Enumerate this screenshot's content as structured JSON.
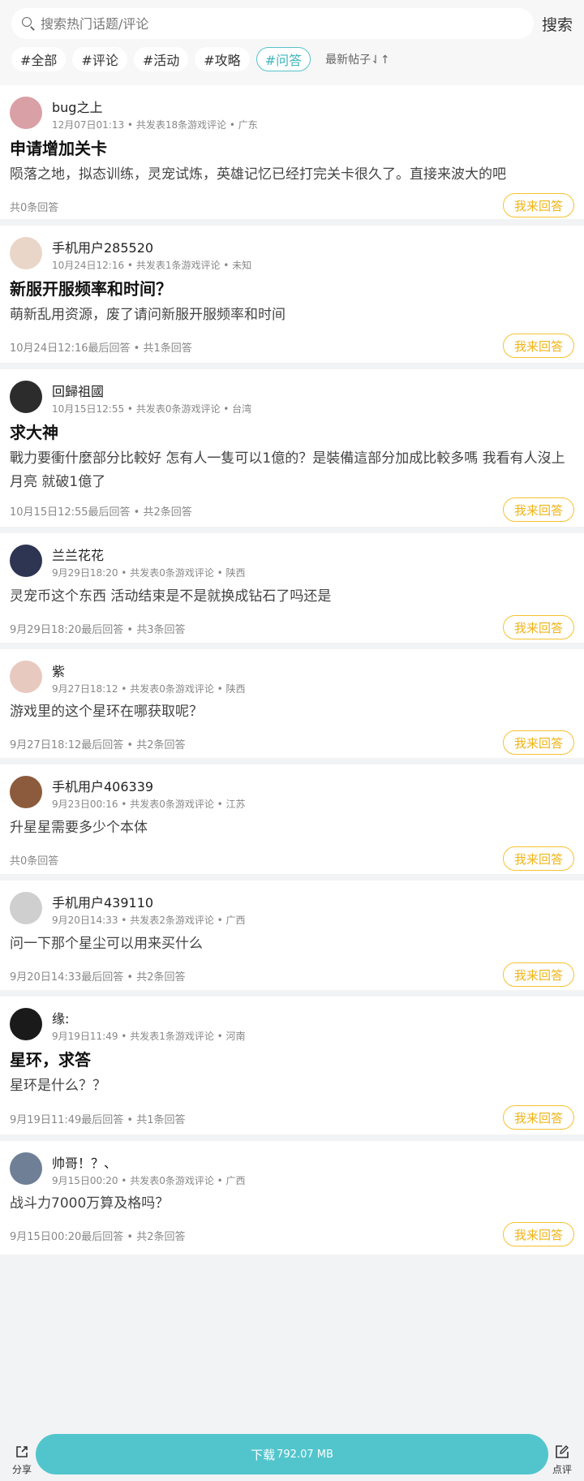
{
  "search": {
    "placeholder": "搜索热门话题/评论",
    "button_label": "搜索"
  },
  "tags": [
    {
      "label": "#全部",
      "active": false
    },
    {
      "label": "#评论",
      "active": false
    },
    {
      "label": "#活动",
      "active": false
    },
    {
      "label": "#攻略",
      "active": false
    },
    {
      "label": "#问答",
      "active": true
    }
  ],
  "sort_label": "最新帖子⇃↑",
  "answer_label": "我来回答",
  "posts": [
    {
      "author": "bug之上",
      "meta": "12月07日01:13 • 共发表18条游戏评论 • 广东",
      "title": "申请增加关卡",
      "content": "陨落之地，拟态训练，灵宠试炼，英雄记忆已经打完关卡很久了。直接来波大的吧",
      "stats": "共0条回答"
    },
    {
      "author": "手机用户285520",
      "meta": "10月24日12:16 • 共发表1条游戏评论 • 未知",
      "title": "新服开服频率和时间？",
      "content": "萌新乱用资源，废了请问新服开服频率和时间",
      "stats": "10月24日12:16最后回答 • 共1条回答"
    },
    {
      "author": "回歸祖國",
      "meta": "10月15日12:55 • 共发表0条游戏评论 • 台湾",
      "title": "求大神",
      "content": "戰力要衝什麼部分比較好 怎有人一隻可以1億的？是裝備這部分加成比較多嗎 我看有人沒上月亮 就破1億了",
      "stats": "10月15日12:55最后回答 • 共2条回答"
    },
    {
      "author": "兰兰花花",
      "meta": "9月29日18:20 • 共发表0条游戏评论 • 陕西",
      "title": "",
      "content": "灵宠币这个东西 活动结束是不是就换成钻石了吗还是",
      "stats": "9月29日18:20最后回答 • 共3条回答"
    },
    {
      "author": "紫",
      "meta": "9月27日18:12 • 共发表0条游戏评论 • 陕西",
      "title": "",
      "content": "游戏里的这个星环在哪获取呢？",
      "stats": "9月27日18:12最后回答 • 共2条回答"
    },
    {
      "author": "手机用户406339",
      "meta": "9月23日00:16 • 共发表0条游戏评论 • 江苏",
      "title": "",
      "content": "升星星需要多少个本体",
      "stats": "共0条回答"
    },
    {
      "author": "手机用户439110",
      "meta": "9月20日14:33 • 共发表2条游戏评论 • 广西",
      "title": "",
      "content": "问一下那个星尘可以用来买什么",
      "stats": "9月20日14:33最后回答 • 共2条回答"
    },
    {
      "author": "缘:",
      "meta": "9月19日11:49 • 共发表1条游戏评论 • 河南",
      "title": "星环，求答",
      "content": "星环是什么？？",
      "stats": "9月19日11:49最后回答 • 共1条回答"
    },
    {
      "author": "帅哥！？、",
      "meta": "9月15日00:20 • 共发表0条游戏评论 • 广西",
      "title": "",
      "content": "战斗力7000万算及格吗？",
      "stats": "9月15日00:20最后回答 • 共2条回答"
    }
  ],
  "bottom": {
    "share_label": "分享",
    "download_label": "下载",
    "download_size": "792.07 MB",
    "rate_label": "点评"
  },
  "colors": {
    "accent": "#52c5cc",
    "answer": "#f5c232",
    "avatars": [
      "#d9a0a6",
      "#e9d6c9",
      "#2c2c2c",
      "#2d3552",
      "#e8c9bf",
      "#8c5a3c",
      "#cfcfcf",
      "#1a1a1a",
      "#6e7f96"
    ]
  }
}
